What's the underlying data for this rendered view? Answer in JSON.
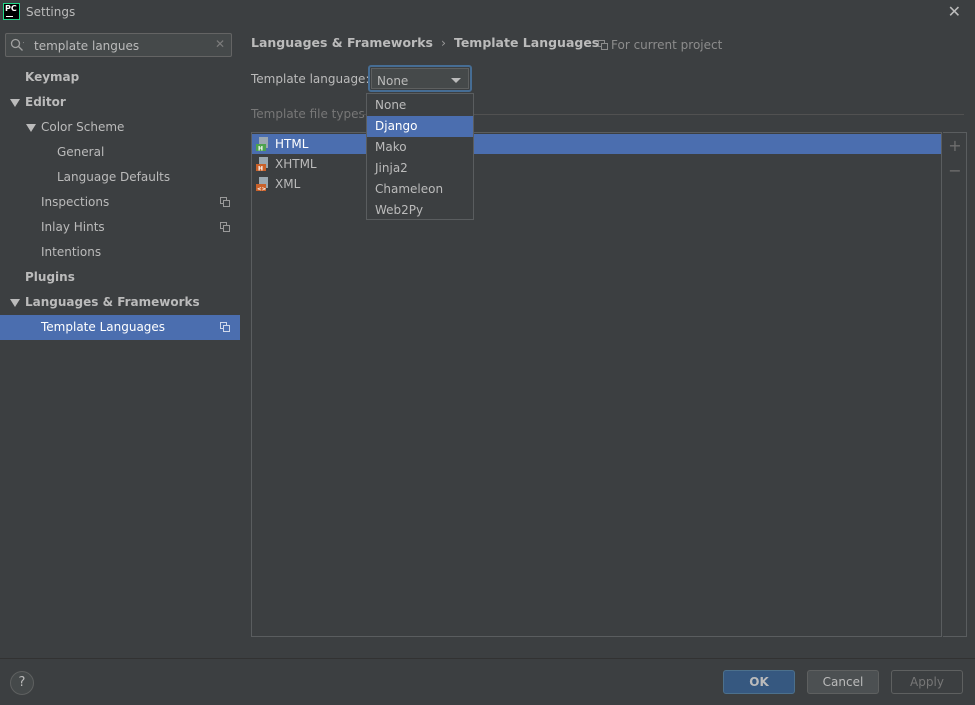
{
  "window": {
    "title": "Settings",
    "logo_text": "PC"
  },
  "search": {
    "value": "template langues",
    "placeholder": ""
  },
  "sidebar": {
    "items": [
      {
        "label": "Keymap"
      },
      {
        "label": "Editor"
      },
      {
        "label": "Color Scheme"
      },
      {
        "label": "General"
      },
      {
        "label": "Language Defaults"
      },
      {
        "label": "Inspections"
      },
      {
        "label": "Inlay Hints"
      },
      {
        "label": "Intentions"
      },
      {
        "label": "Plugins"
      },
      {
        "label": "Languages & Frameworks"
      },
      {
        "label": "Template Languages"
      }
    ]
  },
  "main": {
    "breadcrumb": [
      "Languages & Frameworks",
      "Template Languages"
    ],
    "breadcrumb_sep": "›",
    "for_project": "For current project",
    "template_language_label": "Template language:",
    "template_language_value": "None",
    "file_types_label": "Template file types",
    "file_types": [
      {
        "name": "HTML",
        "icon": "html-file-icon"
      },
      {
        "name": "XHTML",
        "icon": "xhtml-file-icon"
      },
      {
        "name": "XML",
        "icon": "xml-file-icon"
      }
    ],
    "add_symbol": "+",
    "remove_symbol": "−"
  },
  "dropdown": {
    "options": [
      "None",
      "Django",
      "Mako",
      "Jinja2",
      "Chameleon",
      "Web2Py"
    ],
    "highlighted": "Django"
  },
  "footer": {
    "help": "?",
    "ok": "OK",
    "cancel": "Cancel",
    "apply": "Apply"
  },
  "colors": {
    "background": "#3c3f41",
    "selection": "#4b6eaf",
    "ok_button": "#365880",
    "focus_border": "#466d94"
  }
}
